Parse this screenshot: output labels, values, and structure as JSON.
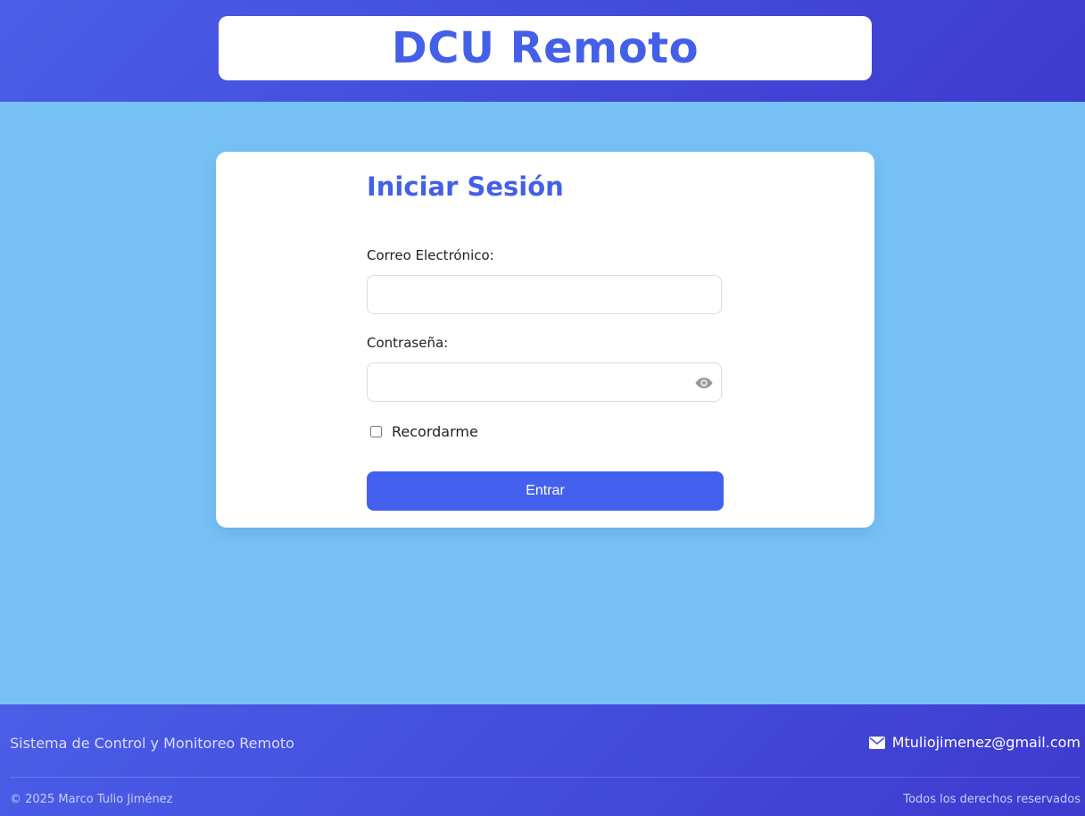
{
  "header": {
    "title": "DCU Remoto"
  },
  "login": {
    "heading": "Iniciar Sesión",
    "email_label": "Correo Electrónico:",
    "email_value": "",
    "email_placeholder": "",
    "password_label": "Contraseña:",
    "password_value": "",
    "password_placeholder": "",
    "toggle_password_icon": "eye-icon",
    "remember_label": "Recordarme",
    "remember_checked": false,
    "submit_label": "Entrar"
  },
  "footer": {
    "description": "Sistema de Control y Monitoreo Remoto",
    "email_icon": "envelope-icon",
    "email": "Mtuliojimenez@gmail.com",
    "copyright": "© 2025 Marco Tulio Jiménez",
    "rights": "Todos los derechos reservados"
  },
  "colors": {
    "brand": "#4460e8",
    "header_bg": "#4a5ee8",
    "page_bg": "#76c2f6",
    "button_bg": "#4361ee"
  }
}
